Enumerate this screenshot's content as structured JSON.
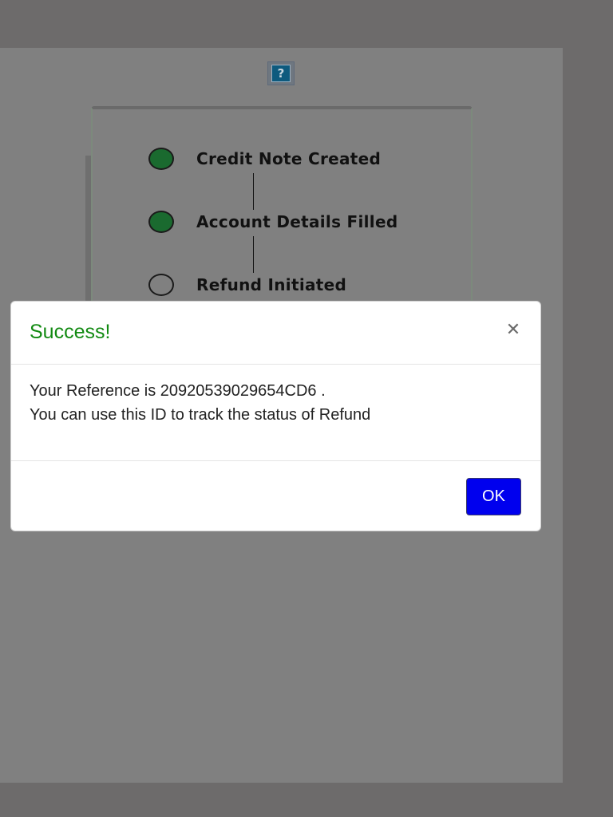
{
  "help": {
    "icon_glyph": "?"
  },
  "tracker": {
    "steps": [
      {
        "label": "Credit Note Created",
        "status": "done"
      },
      {
        "label": "Account Details Filled",
        "status": "done"
      },
      {
        "label": "Refund Initiated",
        "status": "pending"
      }
    ]
  },
  "modal": {
    "title": "Success!",
    "close_glyph": "✕",
    "line1": "Your Reference is 20920539029654CD6 .",
    "line2": "You can use this ID to track the status of Refund",
    "ok_label": "OK"
  },
  "colors": {
    "success_title": "#128a12",
    "ok_button": "#0000ee",
    "step_done": "#1a6a2f"
  }
}
